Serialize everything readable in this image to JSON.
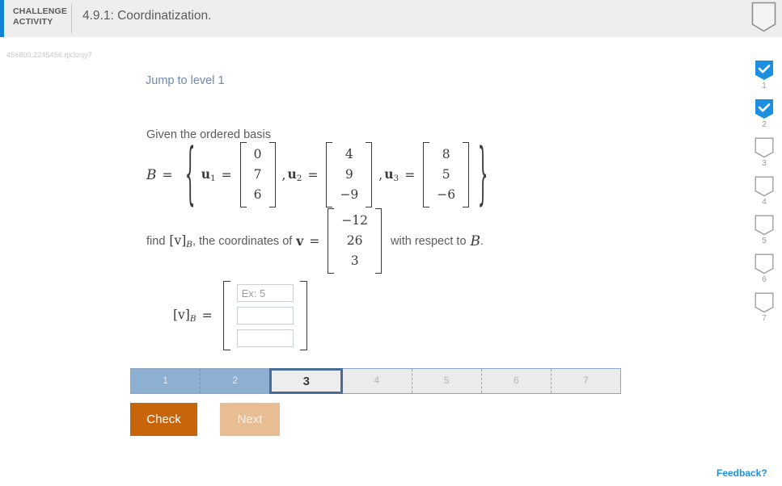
{
  "header": {
    "activity_label_line1": "CHALLENGE",
    "activity_label_line2": "ACTIVITY",
    "title": "4.9.1: Coordinatization.",
    "bookmark_icon": "bookmark-outline-icon",
    "accent_color": "#0f84d8",
    "background_color": "#eeeeee"
  },
  "activity_id": "456800.2245456.qx3zqy7",
  "main": {
    "jump_link": "Jump to level 1",
    "jump_link_color": "#6b8ab4",
    "prompt_prefix": "Given the ordered basis",
    "basis": {
      "symbol": "B",
      "equals": "=",
      "vectors": [
        {
          "name": "u",
          "index": "1",
          "values": [
            "0",
            "7",
            "6"
          ]
        },
        {
          "name": "u",
          "index": "2",
          "values": [
            "4",
            "9",
            "−9"
          ]
        },
        {
          "name": "u",
          "index": "3",
          "values": [
            "8",
            "5",
            "−6"
          ]
        }
      ]
    },
    "find": {
      "lead": "find",
      "coord_symbol": "[v]",
      "coord_sub": "B",
      "middle": ", the coordinates of",
      "v_symbol": "v",
      "equals": "=",
      "v_values": [
        "−12",
        "26",
        "3"
      ],
      "trailing": "with respect to",
      "basis_symbol": "B",
      "period": "."
    },
    "answer": {
      "coord_symbol": "[v]",
      "coord_sub": "B",
      "equals": "=",
      "inputs": [
        {
          "value": "",
          "placeholder": "Ex: 5"
        },
        {
          "value": "",
          "placeholder": ""
        },
        {
          "value": "",
          "placeholder": ""
        }
      ]
    }
  },
  "progress": {
    "segments": [
      {
        "label": "1",
        "state": "done"
      },
      {
        "label": "2",
        "state": "done"
      },
      {
        "label": "3",
        "state": "current"
      },
      {
        "label": "4",
        "state": "pending"
      },
      {
        "label": "5",
        "state": "pending"
      },
      {
        "label": "6",
        "state": "pending"
      },
      {
        "label": "7",
        "state": "pending"
      }
    ],
    "done_color": "#8cafd2",
    "pending_color": "#ebebeb",
    "current_border_color": "#4a6c99"
  },
  "buttons": {
    "check": "Check",
    "next": "Next",
    "check_color": "#c8640a",
    "next_color": "#e8bd93"
  },
  "rail": {
    "items": [
      {
        "number": "1",
        "state": "complete",
        "icon": "bookmark-check-icon"
      },
      {
        "number": "2",
        "state": "complete",
        "icon": "bookmark-check-icon"
      },
      {
        "number": "3",
        "state": "empty",
        "icon": "bookmark-outline-icon"
      },
      {
        "number": "4",
        "state": "empty",
        "icon": "bookmark-outline-icon"
      },
      {
        "number": "5",
        "state": "empty",
        "icon": "bookmark-outline-icon"
      },
      {
        "number": "6",
        "state": "empty",
        "icon": "bookmark-outline-icon"
      },
      {
        "number": "7",
        "state": "empty",
        "icon": "bookmark-outline-icon"
      }
    ],
    "complete_color": "#1d8fe0"
  },
  "feedback": {
    "label": "Feedback?",
    "color": "#1d8fe0"
  }
}
